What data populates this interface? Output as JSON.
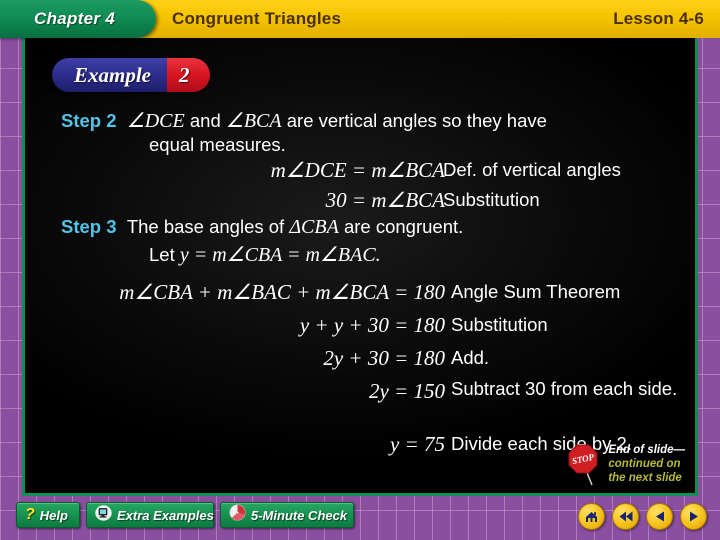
{
  "header": {
    "chapter": "Chapter 4",
    "title": "Congruent Triangles",
    "lesson": "Lesson 4-6"
  },
  "example_badge": {
    "label": "Example",
    "number": "2"
  },
  "colors": {
    "frame_purple": "#8a4f9e",
    "header_yellow": "#f5c400",
    "chapter_green": "#0f8a52",
    "panel_black": "#060606",
    "step_cyan": "#52c4e8",
    "pill_blue": "#2b2b88",
    "pill_red": "#d4141f",
    "button_green": "#17914f",
    "nav_yellow": "#f5c21c",
    "eos_olive": "#b8b83a"
  },
  "body": {
    "step2_label": "Step 2",
    "step2_text_a": "∠DCE",
    "step2_text_b": " and ",
    "step2_text_c": "∠BCA",
    "step2_text_d": " are vertical angles so they have",
    "step2_text_line2": "equal measures.",
    "step3_label": "Step 3",
    "step3_text": "The base angles of ",
    "step3_text_tri": "ΔCBA",
    "step3_text_end": " are congruent.",
    "step3_let_prefix": "Let ",
    "step3_let_math": "y = m∠CBA = m∠BAC."
  },
  "proof": {
    "rows": [
      {
        "statement": "m∠DCE = m∠BCA",
        "reason": "Def. of vertical angles"
      },
      {
        "statement": "30 = m∠BCA",
        "reason": "Substitution"
      },
      {
        "statement": "m∠CBA + m∠BAC + m∠BCA = 180",
        "reason": "Angle Sum Theorem"
      },
      {
        "statement": "y + y + 30 = 180",
        "reason": "Substitution"
      },
      {
        "statement": "2y + 30 = 180",
        "reason": "Add."
      },
      {
        "statement": "2y = 150",
        "reason": "Subtract 30 from each side."
      },
      {
        "statement": "y = 75",
        "reason": "Divide each side by 2."
      }
    ]
  },
  "end_of_slide": {
    "line1": "End of slide—",
    "line2": "continued on",
    "line3": "the next slide",
    "icon": "stop-sign-icon",
    "stop_text": "STOP"
  },
  "toolbar": {
    "help_label": "Help",
    "help_icon": "question-mark-icon",
    "extra_examples_label": "Extra Examples",
    "extra_examples_icon": "computer-monitor-icon",
    "five_minute_check_label": "5-Minute Check",
    "five_minute_check_icon": "clock-icon",
    "nav": [
      {
        "name": "home-icon",
        "glyph": "⌂"
      },
      {
        "name": "rewind-icon",
        "glyph": "◀◀"
      },
      {
        "name": "previous-icon",
        "glyph": "◀"
      },
      {
        "name": "next-icon",
        "glyph": "▶"
      }
    ]
  }
}
